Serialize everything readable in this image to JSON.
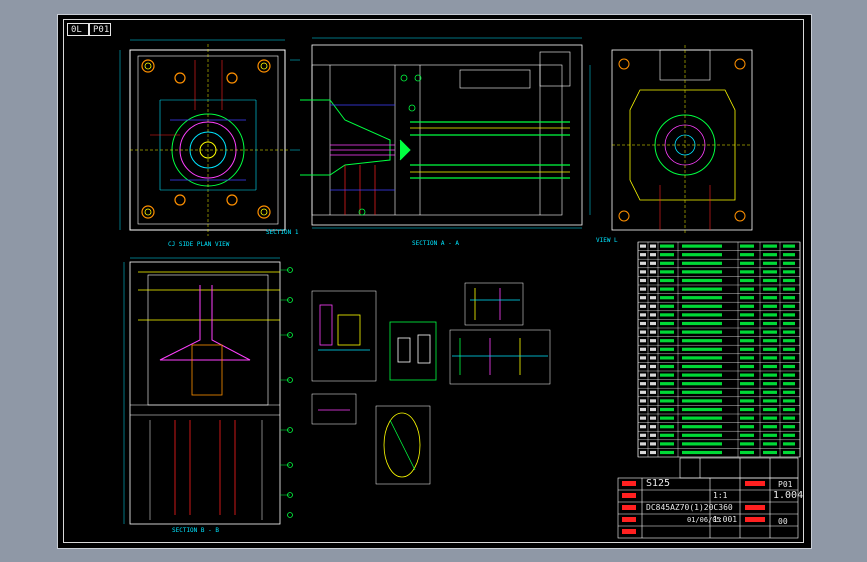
{
  "sheet": {
    "tags": [
      "0L",
      "P01"
    ]
  },
  "views": {
    "plan_view": "CJ SIDE PLAN VIEW",
    "section_a": "SECTION A - A",
    "section_b": "SECTION B - B",
    "corner_code": "SECTION 1",
    "view_left_code": "VIEW L"
  },
  "title_block": {
    "series": "S125",
    "drawing_number": "DC845AZ70(1)20C360",
    "scale": "1:1",
    "sheet_no": "1.004",
    "date": "01/06/05",
    "rev": "00",
    "page": "P01",
    "label_code": "1:001"
  },
  "colors": {
    "outline": "#ffffff",
    "cyan": "#00e5ff",
    "green": "#00ff40",
    "yellow": "#ffff00",
    "red": "#ff2020",
    "magenta": "#ff40ff",
    "blue": "#4040ff",
    "orange": "#ff9000"
  }
}
